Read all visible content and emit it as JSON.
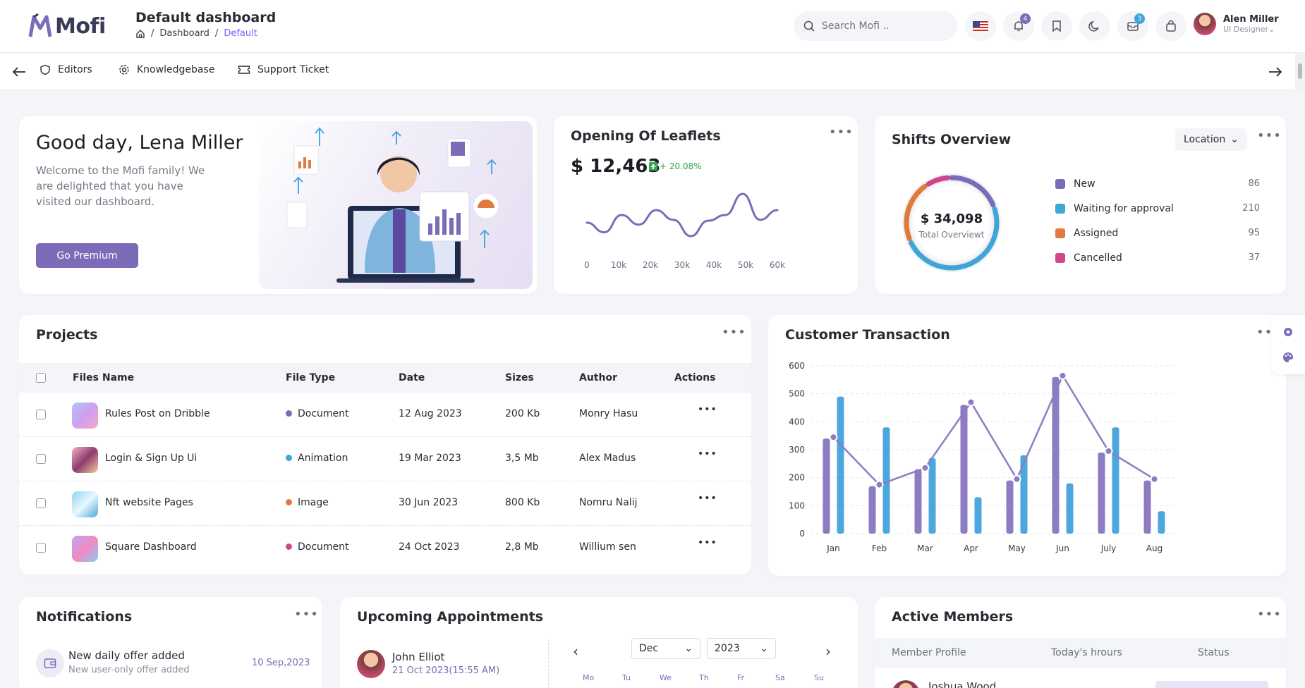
{
  "brand": {
    "logo_text": "Mofi"
  },
  "header": {
    "title": "Default dashboard",
    "breadcrumb": [
      "Dashboard",
      "Default"
    ],
    "search_placeholder": "Search Mofi ..",
    "notif_count": "4",
    "msg_count": "3"
  },
  "user": {
    "name": "Alen Miller",
    "role": "UI Designer"
  },
  "subnav": {
    "items": [
      "Editors",
      "Knowledgebase",
      "Support Ticket"
    ]
  },
  "welcome": {
    "greeting": "Good day, Lena Miller",
    "message": "Welcome to the Mofi family! We are delighted that you have visited our dashboard.",
    "cta": "Go Premium"
  },
  "leaflets": {
    "title": "Opening Of Leaflets",
    "amount": "$ 12,463",
    "change": "+ 20.08%",
    "ticks": [
      "0",
      "10k",
      "20k",
      "30k",
      "40k",
      "50k",
      "60k"
    ],
    "series": [
      32,
      22,
      40,
      30,
      45,
      35,
      18,
      34,
      40,
      62,
      35,
      45
    ]
  },
  "shifts": {
    "title": "Shifts Overview",
    "filter": "Location",
    "total": "$ 34,098",
    "total_label": "Total Overviewt",
    "items": [
      {
        "label": "New",
        "value": "86",
        "color": "#7b6bb8"
      },
      {
        "label": "Waiting for approval",
        "value": "210",
        "color": "#3fa6d8"
      },
      {
        "label": "Assigned",
        "value": "95",
        "color": "#e07a3f"
      },
      {
        "label": "Cancelled",
        "value": "37",
        "color": "#d0468d"
      }
    ]
  },
  "projects": {
    "title": "Projects",
    "columns": [
      "Files Name",
      "File Type",
      "Date",
      "Sizes",
      "Author",
      "Actions"
    ],
    "rows": [
      {
        "name": "Rules Post on Dribble",
        "type": "Document",
        "type_color": "#7b6bb8",
        "date": "12 Aug 2023",
        "size": "200 Kb",
        "author": "Monry Hasu"
      },
      {
        "name": "Login & Sign Up Ui",
        "type": "Animation",
        "type_color": "#3fa6d8",
        "date": "19 Mar 2023",
        "size": "3,5 Mb",
        "author": "Alex Madus"
      },
      {
        "name": "Nft website Pages",
        "type": "Image",
        "type_color": "#e07a3f",
        "date": "30 Jun 2023",
        "size": "800 Kb",
        "author": "Nomru Nalij"
      },
      {
        "name": "Square Dashboard",
        "type": "Document",
        "type_color": "#d0468d",
        "date": "24 Oct 2023",
        "size": "2,8 Mb",
        "author": "Willium sen"
      }
    ]
  },
  "transaction": {
    "title": "Customer Transaction"
  },
  "chart_data": {
    "type": "bar",
    "categories": [
      "Jan",
      "Feb",
      "Mar",
      "Apr",
      "May",
      "Jun",
      "July",
      "Aug"
    ],
    "series": [
      {
        "values": [
          340,
          170,
          230,
          460,
          190,
          560,
          290,
          190
        ],
        "color": "#8e7cc3"
      },
      {
        "values": [
          490,
          380,
          270,
          130,
          280,
          180,
          380,
          80
        ],
        "color": "#4ba7dd"
      },
      {
        "type": "line",
        "values": [
          345,
          175,
          235,
          470,
          195,
          565,
          295,
          195
        ],
        "color": "#8e7cc3"
      }
    ],
    "ylim": [
      0,
      600
    ],
    "yticks": [
      0,
      100,
      200,
      300,
      400,
      500,
      600
    ]
  },
  "notifications": {
    "title": "Notifications",
    "items": [
      {
        "title": "New daily offer added",
        "sub": "New user-only offer added",
        "date": "10 Sep,2023"
      }
    ]
  },
  "appointments": {
    "title": "Upcoming Appointments",
    "items": [
      {
        "name": "John Elliot",
        "time": "21 Oct 2023(15:55 AM)"
      }
    ],
    "month": "Dec",
    "year": "2023",
    "weekdays": [
      "Mo",
      "Tu",
      "We",
      "Th",
      "Fr",
      "Sa",
      "Su"
    ]
  },
  "members": {
    "title": "Active Members",
    "columns": [
      "Member Profile",
      "Today's hrours",
      "Status"
    ],
    "first": "Joshua Wood"
  }
}
